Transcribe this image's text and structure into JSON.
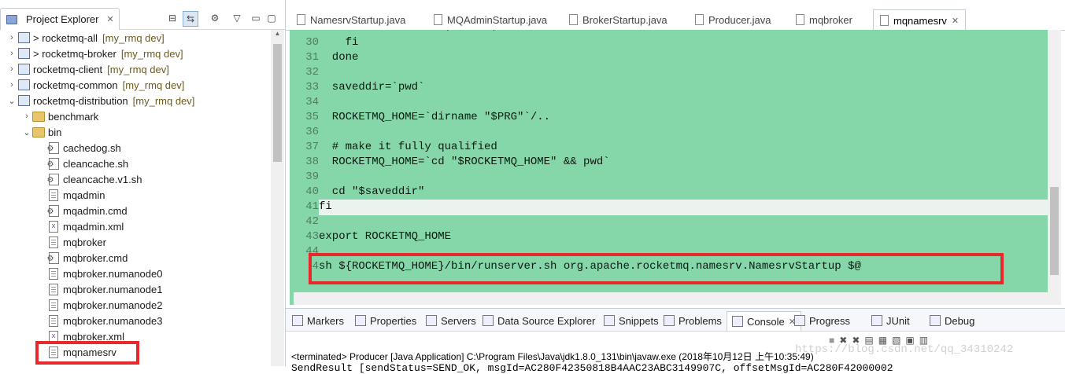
{
  "explorer": {
    "title": "Project Explorer",
    "items": [
      {
        "label": "> rocketmq-all",
        "repo": "[my_rmq dev]",
        "icon": "project-icon",
        "twisty": ">"
      },
      {
        "label": "> rocketmq-broker",
        "repo": "[my_rmq dev]",
        "icon": "project-icon",
        "twisty": ">"
      },
      {
        "label": "rocketmq-client",
        "repo": "[my_rmq dev]",
        "icon": "project-icon",
        "twisty": ">"
      },
      {
        "label": "rocketmq-common",
        "repo": "[my_rmq dev]",
        "icon": "project-icon",
        "twisty": ">"
      },
      {
        "label": "rocketmq-distribution",
        "repo": "[my_rmq dev]",
        "icon": "project-icon",
        "twisty": "v"
      },
      {
        "label": "benchmark",
        "repo": "",
        "icon": "folder-icon",
        "twisty": ">"
      },
      {
        "label": "bin",
        "repo": "",
        "icon": "folder-icon",
        "twisty": "v"
      },
      {
        "label": "cachedog.sh",
        "repo": "",
        "icon": "script-file-icon",
        "twisty": ""
      },
      {
        "label": "cleancache.sh",
        "repo": "",
        "icon": "script-file-icon",
        "twisty": ""
      },
      {
        "label": "cleancache.v1.sh",
        "repo": "",
        "icon": "script-file-icon",
        "twisty": ""
      },
      {
        "label": "mqadmin",
        "repo": "",
        "icon": "text-file-icon",
        "twisty": ""
      },
      {
        "label": "mqadmin.cmd",
        "repo": "",
        "icon": "script-file-icon",
        "twisty": ""
      },
      {
        "label": "mqadmin.xml",
        "repo": "",
        "icon": "xml-file-icon",
        "twisty": ""
      },
      {
        "label": "mqbroker",
        "repo": "",
        "icon": "text-file-icon",
        "twisty": ""
      },
      {
        "label": "mqbroker.cmd",
        "repo": "",
        "icon": "script-file-icon",
        "twisty": ""
      },
      {
        "label": "mqbroker.numanode0",
        "repo": "",
        "icon": "text-file-icon",
        "twisty": ""
      },
      {
        "label": "mqbroker.numanode1",
        "repo": "",
        "icon": "text-file-icon",
        "twisty": ""
      },
      {
        "label": "mqbroker.numanode2",
        "repo": "",
        "icon": "text-file-icon",
        "twisty": ""
      },
      {
        "label": "mqbroker.numanode3",
        "repo": "",
        "icon": "text-file-icon",
        "twisty": ""
      },
      {
        "label": "mqbroker.xml",
        "repo": "",
        "icon": "xml-file-icon",
        "twisty": ""
      },
      {
        "label": "mqnamesrv",
        "repo": "",
        "icon": "text-file-icon",
        "twisty": ""
      }
    ]
  },
  "editor": {
    "tabs": [
      {
        "label": "NamesrvStartup.java",
        "active": false
      },
      {
        "label": "MQAdminStartup.java",
        "active": false
      },
      {
        "label": "BrokerStartup.java",
        "active": false
      },
      {
        "label": "Producer.java",
        "active": false
      },
      {
        "label": "mqbroker",
        "active": false
      },
      {
        "label": "mqnamesrv",
        "active": true
      }
    ],
    "lines": [
      {
        "n": "",
        "text": "    PRG=\"`dirname \"$PRG\"`/$link\""
      },
      {
        "n": "30",
        "text": "    fi"
      },
      {
        "n": "31",
        "text": "  done"
      },
      {
        "n": "32",
        "text": ""
      },
      {
        "n": "33",
        "text": "  saveddir=`pwd`"
      },
      {
        "n": "34",
        "text": ""
      },
      {
        "n": "35",
        "text": "  ROCKETMQ_HOME=`dirname \"$PRG\"`/.."
      },
      {
        "n": "36",
        "text": ""
      },
      {
        "n": "37",
        "text": "  # make it fully qualified"
      },
      {
        "n": "38",
        "text": "  ROCKETMQ_HOME=`cd \"$ROCKETMQ_HOME\" && pwd`"
      },
      {
        "n": "39",
        "text": ""
      },
      {
        "n": "40",
        "text": "  cd \"$saveddir\""
      },
      {
        "n": "41",
        "text": "fi"
      },
      {
        "n": "42",
        "text": ""
      },
      {
        "n": "43",
        "text": "export ROCKETMQ_HOME"
      },
      {
        "n": "44",
        "text": ""
      },
      {
        "n": "4",
        "text": "sh ${ROCKETMQ_HOME}/bin/runserver.sh org.apache.rocketmq.namesrv.NamesrvStartup $@"
      }
    ]
  },
  "bottom": {
    "tabs": [
      "Markers",
      "Properties",
      "Servers",
      "Data Source Explorer",
      "Snippets",
      "Problems",
      "Console",
      "Progress",
      "JUnit",
      "Debug"
    ],
    "active_tab": "Console",
    "terminated": "<terminated> Producer [Java Application] C:\\Program Files\\Java\\jdk1.8.0_131\\bin\\javaw.exe (2018年10月12日 上午10:35:49)",
    "output": "SendResult [sendStatus=SEND_OK, msgId=AC280F42350818B4AAC23ABC3149907C, offsetMsgId=AC280F42000002",
    "watermark": "https://blog.csdn.net/qq_34310242"
  },
  "colors": {
    "editor_bg": "#85d6a8",
    "highlight_box": "#e8282b"
  }
}
